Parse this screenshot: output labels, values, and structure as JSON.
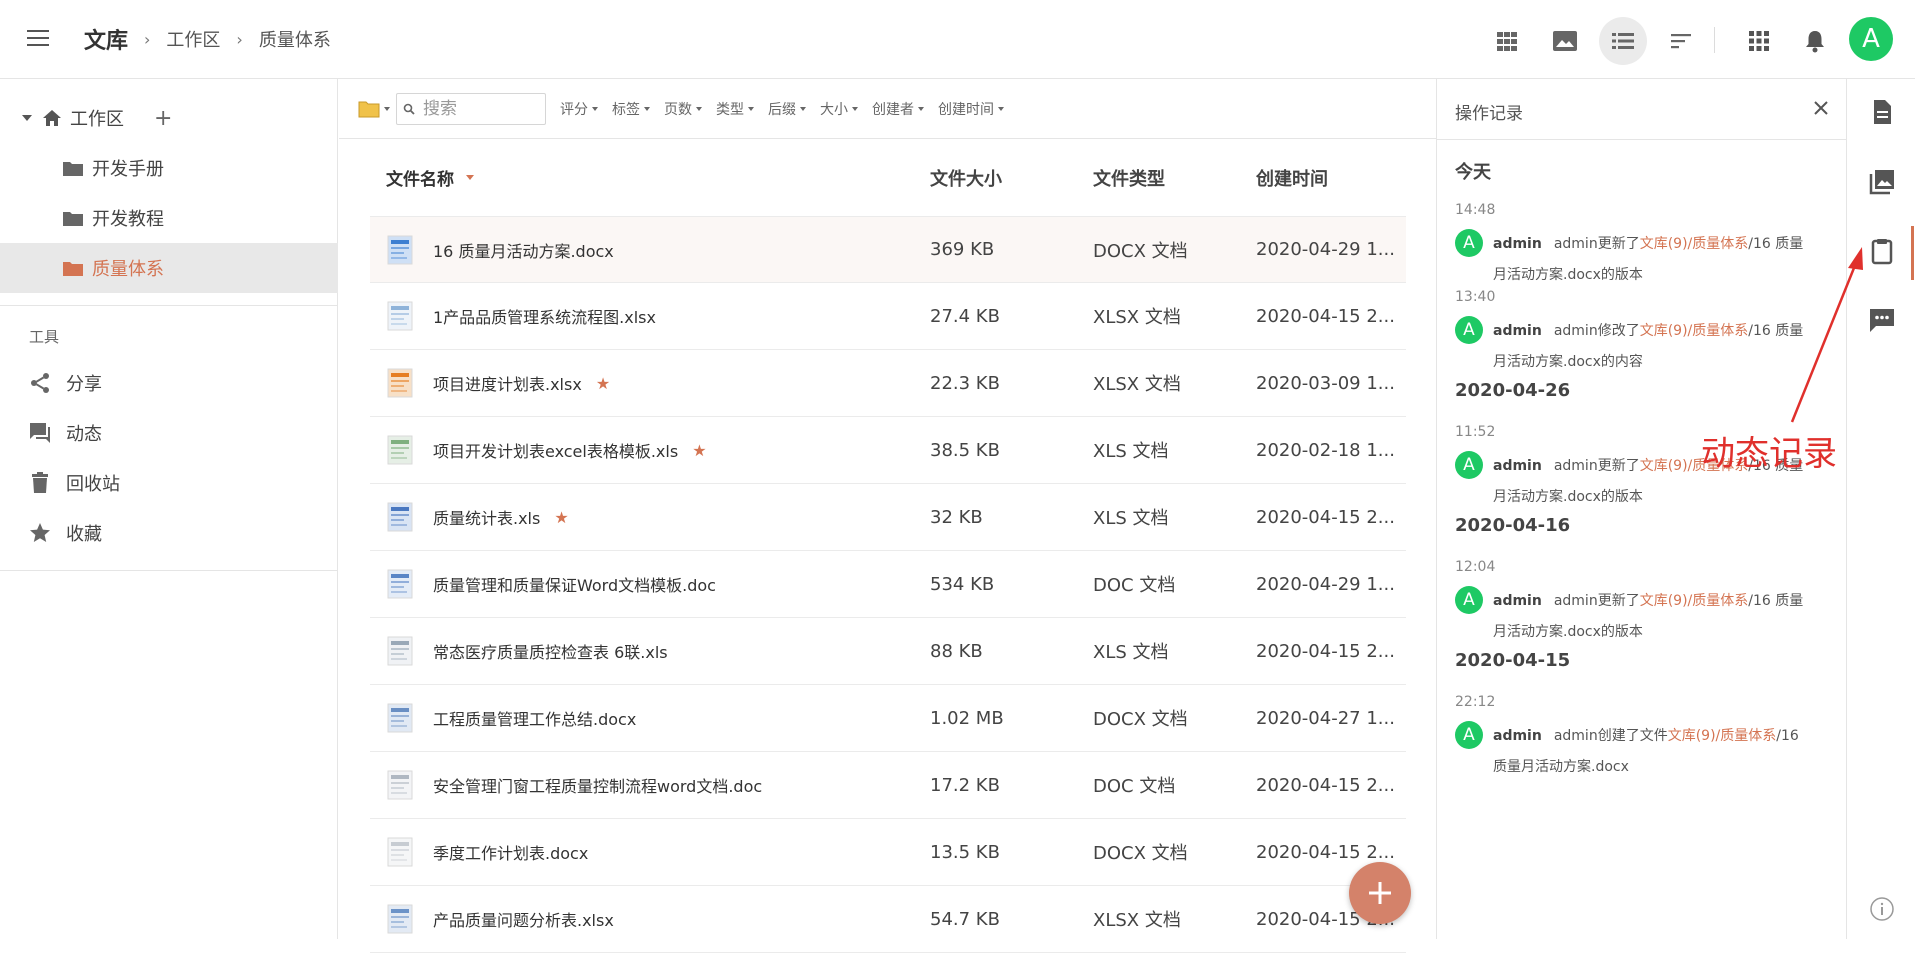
{
  "topbar": {
    "breadcrumb": {
      "root": "文库",
      "level1": "工作区",
      "level2": "质量体系"
    },
    "avatar_letter": "A",
    "icons": [
      "grid-view-icon",
      "image-view-icon",
      "list-view-icon",
      "sort-icon",
      "apps-icon",
      "bell-icon"
    ]
  },
  "sidebar": {
    "root_label": "工作区",
    "items": [
      {
        "label": "开发手册"
      },
      {
        "label": "开发教程"
      },
      {
        "label": "质量体系"
      }
    ],
    "tools_title": "工具",
    "tools": [
      {
        "label": "分享",
        "icon": "share-icon"
      },
      {
        "label": "动态",
        "icon": "activity-icon"
      },
      {
        "label": "回收站",
        "icon": "trash-icon"
      },
      {
        "label": "收藏",
        "icon": "star-icon"
      }
    ]
  },
  "filterbar": {
    "search_placeholder": "搜索",
    "filters": [
      "评分",
      "标签",
      "页数",
      "类型",
      "后缀",
      "大小",
      "创建者",
      "创建时间"
    ]
  },
  "table": {
    "headers": {
      "name": "文件名称",
      "size": "文件大小",
      "type": "文件类型",
      "time": "创建时间"
    },
    "rows": [
      {
        "name": "16 质量月活动方案.docx",
        "size": "369 KB",
        "type": "DOCX 文档",
        "time": "2020-04-29 1...",
        "starred": ""
      },
      {
        "name": "1产品品质管理系统流程图.xlsx",
        "size": "27.4 KB",
        "type": "XLSX 文档",
        "time": "2020-04-15 2...",
        "starred": ""
      },
      {
        "name": "项目进度计划表.xlsx",
        "size": "22.3 KB",
        "type": "XLSX 文档",
        "time": "2020-03-09 1...",
        "starred": "★"
      },
      {
        "name": "项目开发计划表excel表格模板.xls",
        "size": "38.5 KB",
        "type": "XLS 文档",
        "time": "2020-02-18 1...",
        "starred": "★"
      },
      {
        "name": "质量统计表.xls",
        "size": "32 KB",
        "type": "XLS 文档",
        "time": "2020-04-15 2...",
        "starred": "★"
      },
      {
        "name": "质量管理和质量保证Word文档模板.doc",
        "size": "534 KB",
        "type": "DOC 文档",
        "time": "2020-04-29 1...",
        "starred": ""
      },
      {
        "name": "常态医疗质量质控检查表 6联.xls",
        "size": "88 KB",
        "type": "XLS 文档",
        "time": "2020-04-15 2...",
        "starred": ""
      },
      {
        "name": "工程质量管理工作总结.docx",
        "size": "1.02 MB",
        "type": "DOCX 文档",
        "time": "2020-04-27 1...",
        "starred": ""
      },
      {
        "name": "安全管理门窗工程质量控制流程word文档.doc",
        "size": "17.2 KB",
        "type": "DOC 文档",
        "time": "2020-04-15 2...",
        "starred": ""
      },
      {
        "name": "季度工作计划表.docx",
        "size": "13.5 KB",
        "type": "DOCX 文档",
        "time": "2020-04-15 2...",
        "starred": ""
      },
      {
        "name": "产品质量问题分析表.xlsx",
        "size": "54.7 KB",
        "type": "XLSX 文档",
        "time": "2020-04-15 2...",
        "starred": ""
      }
    ]
  },
  "panel": {
    "title": "操作记录",
    "groups": [
      {
        "day": "今天",
        "entries": [
          {
            "time": "14:48",
            "user": "admin",
            "pre": "admin更新了",
            "link": "文库(9)/质量体系",
            "post": "/16 质量",
            "line2": "月活动方案.docx的版本"
          },
          {
            "time": "13:40",
            "user": "admin",
            "pre": "admin修改了",
            "link": "文库(9)/质量体系",
            "post": "/16 质量",
            "line2": "月活动方案.docx的内容"
          }
        ]
      },
      {
        "day": "2020-04-26",
        "entries": [
          {
            "time": "11:52",
            "user": "admin",
            "pre": "admin更新了",
            "link": "文库(9)/质量体系",
            "post": "/16 质量",
            "line2": "月活动方案.docx的版本"
          }
        ]
      },
      {
        "day": "2020-04-16",
        "entries": [
          {
            "time": "12:04",
            "user": "admin",
            "pre": "admin更新了",
            "link": "文库(9)/质量体系",
            "post": "/16 质量",
            "line2": "月活动方案.docx的版本"
          }
        ]
      },
      {
        "day": "2020-04-15",
        "entries": [
          {
            "time": "22:12",
            "user": "admin",
            "pre": "admin创建了文件",
            "link": "文库(9)/质量体系",
            "post": "/16",
            "line2": "质量月活动方案.docx"
          }
        ]
      }
    ]
  },
  "rail": {
    "icons": [
      "document-icon",
      "images-icon",
      "clipboard-icon",
      "comment-icon",
      "info-icon"
    ]
  },
  "annotation": {
    "text": "动态记录",
    "color": "#e0302c"
  },
  "colors": {
    "accent": "#d47452",
    "avatar": "#1ec964",
    "fab": "#d4826a"
  }
}
